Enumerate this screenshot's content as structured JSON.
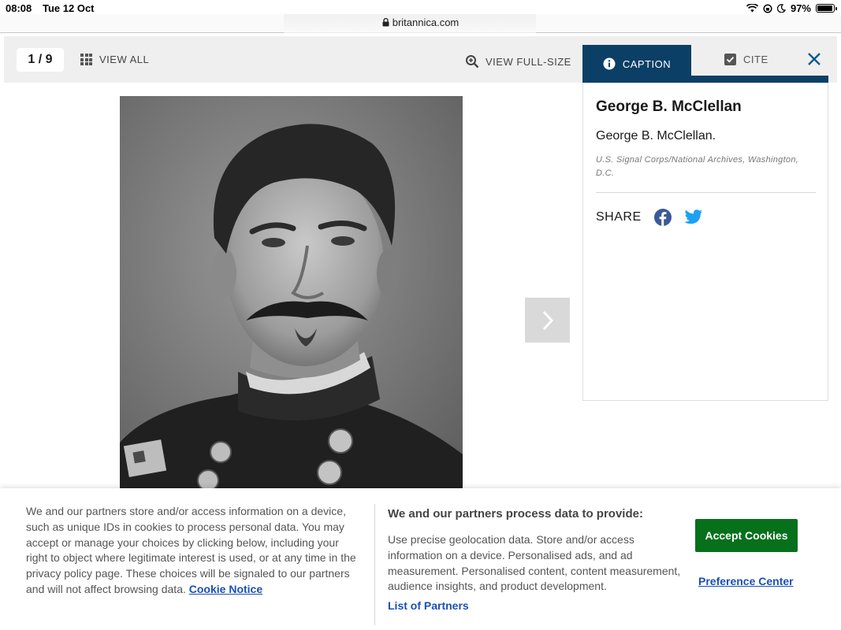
{
  "status_bar": {
    "time": "08:08",
    "date": "Tue 12 Oct",
    "battery": "97%"
  },
  "browser": {
    "url": "britannica.com"
  },
  "toolbar": {
    "counter": "1 / 9",
    "view_all": "VIEW ALL",
    "view_full_size": "VIEW FULL-SIZE",
    "caption_tab": "CAPTION",
    "cite_tab": "CITE"
  },
  "caption": {
    "title": "George B. McClellan",
    "description": "George B. McClellan.",
    "credit": "U.S. Signal Corps/National Archives, Washington, D.C.",
    "share_label": "SHARE"
  },
  "cookie_banner": {
    "notice_text": "We and our partners store and/or access information on a device, such as unique IDs in cookies to process personal data. You may accept or manage your choices by clicking below, including your right to object where legitimate interest is used, or at any time in the privacy policy page. These choices will be signaled to our partners and will not affect browsing data.",
    "cookie_notice_link": "Cookie Notice",
    "purposes_heading": "We and our partners process data to provide:",
    "purposes_text": "Use precise geolocation data. Store and/or access information on a device. Personalised ads, and ad measurement. Personalised content, content measurement, audience insights, and product development.",
    "partners_link": "List of Partners",
    "accept_button": "Accept Cookies",
    "preference_link": "Preference Center"
  },
  "colors": {
    "accent": "#0c3f66",
    "accept": "#06701b",
    "link": "#1a4fb4",
    "facebook": "#3b5998",
    "twitter": "#1da1f2"
  },
  "icons": [
    "lock-icon",
    "wifi-icon",
    "battery-icon",
    "grid-icon",
    "zoom-icon",
    "info-icon",
    "checkbox-icon",
    "close-icon",
    "chevron-right-icon",
    "facebook-icon",
    "twitter-icon"
  ]
}
